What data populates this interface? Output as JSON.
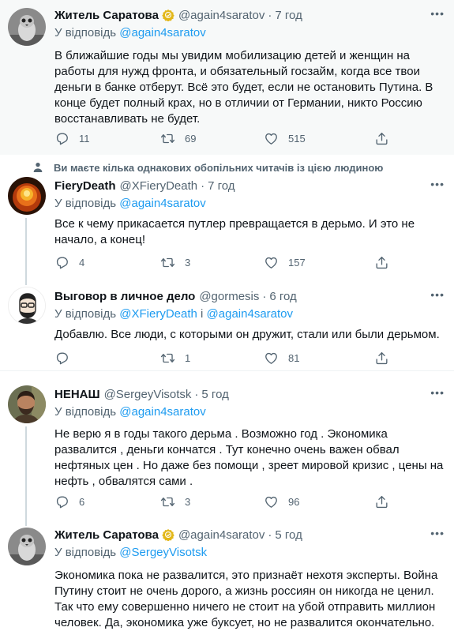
{
  "tweets": [
    {
      "name": "Житель Саратова",
      "handle": "@again4saratov",
      "time": "7 год",
      "reply_prefix": "У відповідь",
      "reply_to": "@again4saratov",
      "text": "В ближайшие годы мы увидим мобилизацию детей и женщин на работы для нужд фронта, и обязательный госзайм, когда все твои деньги в банке отберут. Всё это будет, если не остановить Путина. В конце будет полный крах, но в отличии от Германии, никто Россию восстанавливать не будет.",
      "replies": "11",
      "retweets": "69",
      "likes": "515"
    },
    {
      "name": "FieryDeath",
      "handle": "@XFieryDeath",
      "time": "7 год",
      "reply_prefix": "У відповідь",
      "reply_to": "@again4saratov",
      "text": "Все к чему прикасается путлер превращается в дерьмо. И это не начало, а конец!",
      "replies": "4",
      "retweets": "3",
      "likes": "157"
    },
    {
      "name": "Выговор в личное дело",
      "handle": "@gormesis",
      "time": "6 год",
      "reply_prefix": "У відповідь",
      "reply_to": "@XFieryDeath",
      "reply_joiner": "і",
      "reply_to_2": "@again4saratov",
      "text": "Добавлю. Все люди, с которыми он дружит, стали или были дерьмом.",
      "retweets": "1",
      "likes": "81"
    },
    {
      "name": "НЕНАШ",
      "handle": "@SergeyVisotsk",
      "time": "5 год",
      "reply_prefix": "У відповідь",
      "reply_to": "@again4saratov",
      "text": "Не верю я в годы такого дерьма . Возможно год . Экономика развалится , деньги кончатся . Тут конечно очень важен обвал нефтяных цен . Но даже без помощи , зреет мировой кризис , цены на нефть , обвалятся сами .",
      "replies": "6",
      "retweets": "3",
      "likes": "96"
    },
    {
      "name": "Житель Саратова",
      "handle": "@again4saratov",
      "time": "5 год",
      "reply_prefix": "У відповідь",
      "reply_to": "@SergeyVisotsk",
      "text": "Экономика пока не развалится, это признаёт нехотя эксперты. Война Путину стоит не очень дорого, а жизнь россиян он никогда не ценил. Так что ему совершенно ничего не стоит на убой отправить миллион человек. Да, экономика уже буксует, но не развалится окончательно."
    }
  ],
  "social_context": "Ви маєте кілька однакових обопільних читачів із цією людиною",
  "colors": {
    "accent": "#1d9bf0",
    "secondary_text": "#536471",
    "verified_gold": "#e2b719"
  },
  "icons": [
    "reply-icon",
    "retweet-icon",
    "like-icon",
    "share-icon",
    "more-icon",
    "verified-badge-icon",
    "person-icon"
  ]
}
